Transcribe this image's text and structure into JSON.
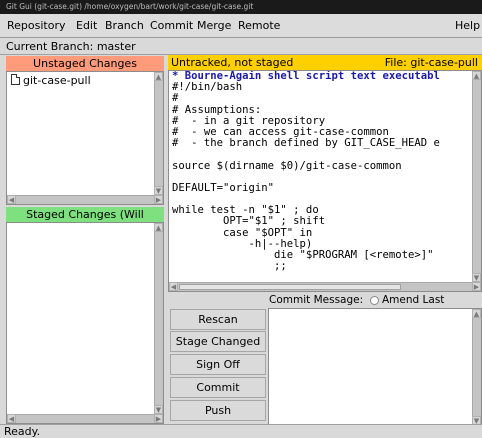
{
  "window": {
    "title": "Git Gui (git-case.git) /home/oxygen/bart/work/git-case/git-case.git"
  },
  "menubar": {
    "items": [
      "Repository",
      "Edit",
      "Branch",
      "Commit",
      "Merge",
      "Remote"
    ],
    "help": "Help"
  },
  "branch": {
    "label": "Current Branch: master"
  },
  "unstaged": {
    "header": "Unstaged Changes",
    "header_color": "#ff9a7a",
    "files": [
      "git-case-pull"
    ]
  },
  "staged": {
    "header": "Staged Changes (Will Commit)",
    "header_color": "#7fe07f",
    "files": []
  },
  "diff": {
    "status": "Untracked, not staged",
    "file_label": "File: git-case-pull",
    "header_color": "#ffd000",
    "lines": [
      "* Bourne-Again shell script text executabl",
      "#!/bin/bash",
      "#",
      "# Assumptions:",
      "#  - in a git repository",
      "#  - we can access git-case-common",
      "#  - the branch defined by GIT_CASE_HEAD e",
      "",
      "source $(dirname $0)/git-case-common",
      "",
      "DEFAULT=\"origin\"",
      "",
      "while test -n \"$1\" ; do",
      "        OPT=\"$1\" ; shift",
      "        case \"$OPT\" in",
      "            -h|--help)",
      "                die \"$PROGRAM [<remote>]\"",
      "                ;;"
    ]
  },
  "commit": {
    "message_label": "Commit Message:",
    "amend_label": "Amend Last Commit",
    "buttons": {
      "rescan": "Rescan",
      "stage_changed": "Stage Changed",
      "sign_off": "Sign Off",
      "commit": "Commit",
      "push": "Push"
    }
  },
  "status": {
    "text": "Ready."
  }
}
